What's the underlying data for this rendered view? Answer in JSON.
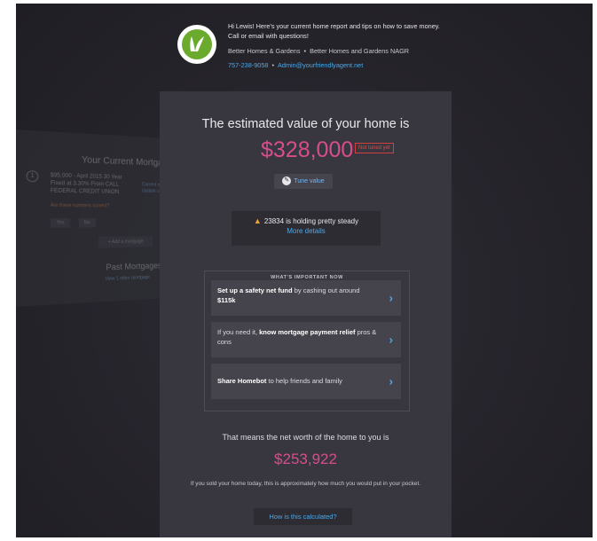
{
  "header": {
    "message": "Hi Lewis! Here's your current home report and tips on how to save money. Call or email with questions!",
    "brand_left": "Better Homes & Gardens",
    "brand_right": "Better Homes and Gardens NAGR",
    "phone": "757-238-9058",
    "email": "Admin@yourfriendlyagent.net"
  },
  "background_card": {
    "title": "Your Current Mortgage",
    "number": "1",
    "line": "$95,000 - April 2015 30 Year Fixed at 3.30% From CALL FEDERAL CREDIT UNION",
    "warning": "Are these numbers correct?",
    "yes": "Yes",
    "no": "No",
    "side": "Current m... Update cur...",
    "add": "+ Add a mortgage",
    "past": "Past Mortgages",
    "view": "View 1 other mortgage"
  },
  "estimate": {
    "title": "The estimated value of your home is",
    "value": "$328,000",
    "badge": "Not tuned yet",
    "tune_label": "Tune value"
  },
  "market": {
    "text": "23834 is holding pretty steady",
    "link": "More details"
  },
  "important": {
    "label": "WHAT'S IMPORTANT NOW",
    "items": [
      {
        "bold": "Set up a safety net fund",
        "rest": " by cashing out around ",
        "bold2": "$115k"
      },
      {
        "pre": "If you need it, ",
        "bold": "know mortgage payment relief",
        "rest": " pros & cons"
      },
      {
        "bold": "Share Homebot",
        "rest": " to help friends and family"
      }
    ]
  },
  "networth": {
    "title": "That means the net worth of the home to you is",
    "value": "$253,922",
    "description": "If you sold your home today, this is approximately how much you would put in your pocket.",
    "calc_label": "How is this calculated?"
  }
}
